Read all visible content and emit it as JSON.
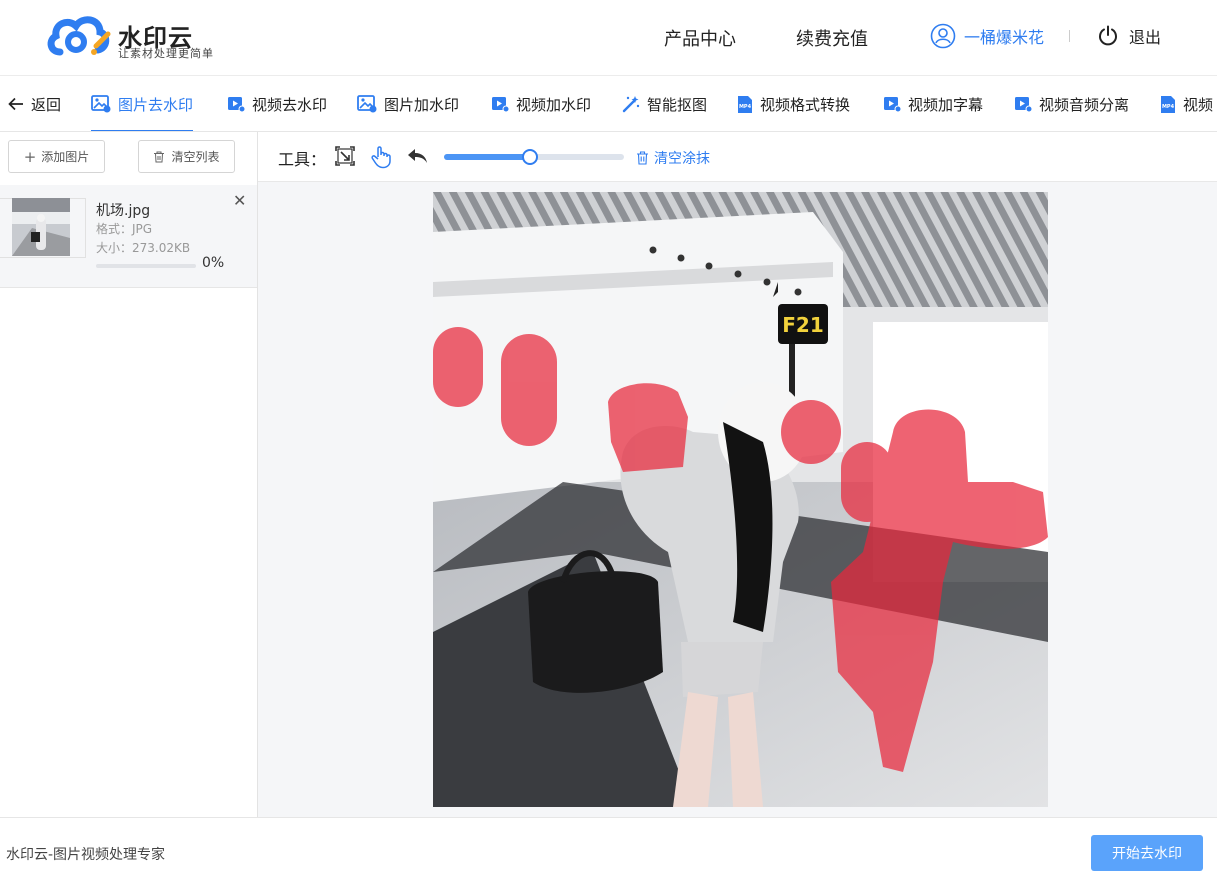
{
  "app": {
    "name": "水印云",
    "slogan": "让素材处理更简单"
  },
  "header": {
    "nav": [
      "产品中心",
      "续费充值"
    ],
    "username": "一桶爆米花",
    "logout": "退出"
  },
  "tabs": {
    "back": "返回",
    "items": [
      {
        "label": "图片去水印",
        "icon": "image-remove-icon",
        "active": true
      },
      {
        "label": "视频去水印",
        "icon": "video-icon"
      },
      {
        "label": "图片加水印",
        "icon": "image-add-icon"
      },
      {
        "label": "视频加水印",
        "icon": "video-icon"
      },
      {
        "label": "智能抠图",
        "icon": "magic-wand-icon"
      },
      {
        "label": "视频格式转换",
        "icon": "mp4-file-icon"
      },
      {
        "label": "视频加字幕",
        "icon": "video-icon"
      },
      {
        "label": "视频音频分离",
        "icon": "video-icon"
      },
      {
        "label": "视频",
        "icon": "mp4-file-icon"
      }
    ]
  },
  "sidebar": {
    "add_image": "添加图片",
    "clear_list": "清空列表",
    "file": {
      "name": "机场.jpg",
      "format": "格式：JPG",
      "size": "大小：273.02KB",
      "progress_value": 0,
      "progress": "0%"
    }
  },
  "toolbar": {
    "label": "工具：",
    "brush_size": 0.48,
    "clear_paint": "清空涂抹"
  },
  "footer": {
    "text": "水印云-图片视频处理专家",
    "start": "开始去水印"
  },
  "colors": {
    "accent": "#2f7df0",
    "button": "#5aa3fb",
    "mask": "#e8283c"
  }
}
